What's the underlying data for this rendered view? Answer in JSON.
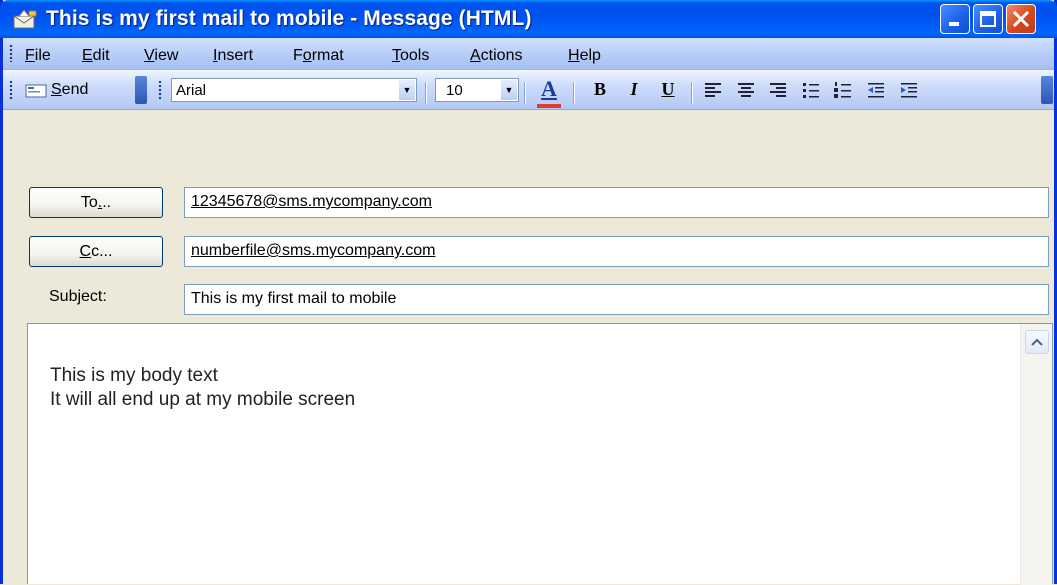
{
  "window": {
    "title": "This is my first mail to mobile - Message (HTML)",
    "icon": "envelope-message-icon",
    "titlebar_color": "#0054e3"
  },
  "menu": {
    "items": [
      {
        "label": "File",
        "accel": "F"
      },
      {
        "label": "Edit",
        "accel": "E"
      },
      {
        "label": "View",
        "accel": "V"
      },
      {
        "label": "Insert",
        "accel": "I"
      },
      {
        "label": "Format",
        "accel": "o"
      },
      {
        "label": "Tools",
        "accel": "T"
      },
      {
        "label": "Actions",
        "accel": "A"
      },
      {
        "label": "Help",
        "accel": "H"
      }
    ]
  },
  "toolbar": {
    "send_label": "Send",
    "font_name": "Arial",
    "font_size": "10",
    "font_color": "#e03b2f",
    "format_buttons": [
      "bold",
      "italic",
      "underline",
      "align-left",
      "align-center",
      "align-right",
      "bullets",
      "numbering",
      "decrease-indent",
      "increase-indent"
    ]
  },
  "header": {
    "to_button": "To...",
    "to_value": "12345678@sms.mycompany.com",
    "cc_button": "Cc...",
    "cc_value": "numberfile@sms.mycompany.com",
    "subject_label": "Subject:",
    "subject_value": "This is my first mail to mobile"
  },
  "body": {
    "lines": [
      "This is my body text",
      "It will all end up at my mobile screen"
    ]
  }
}
